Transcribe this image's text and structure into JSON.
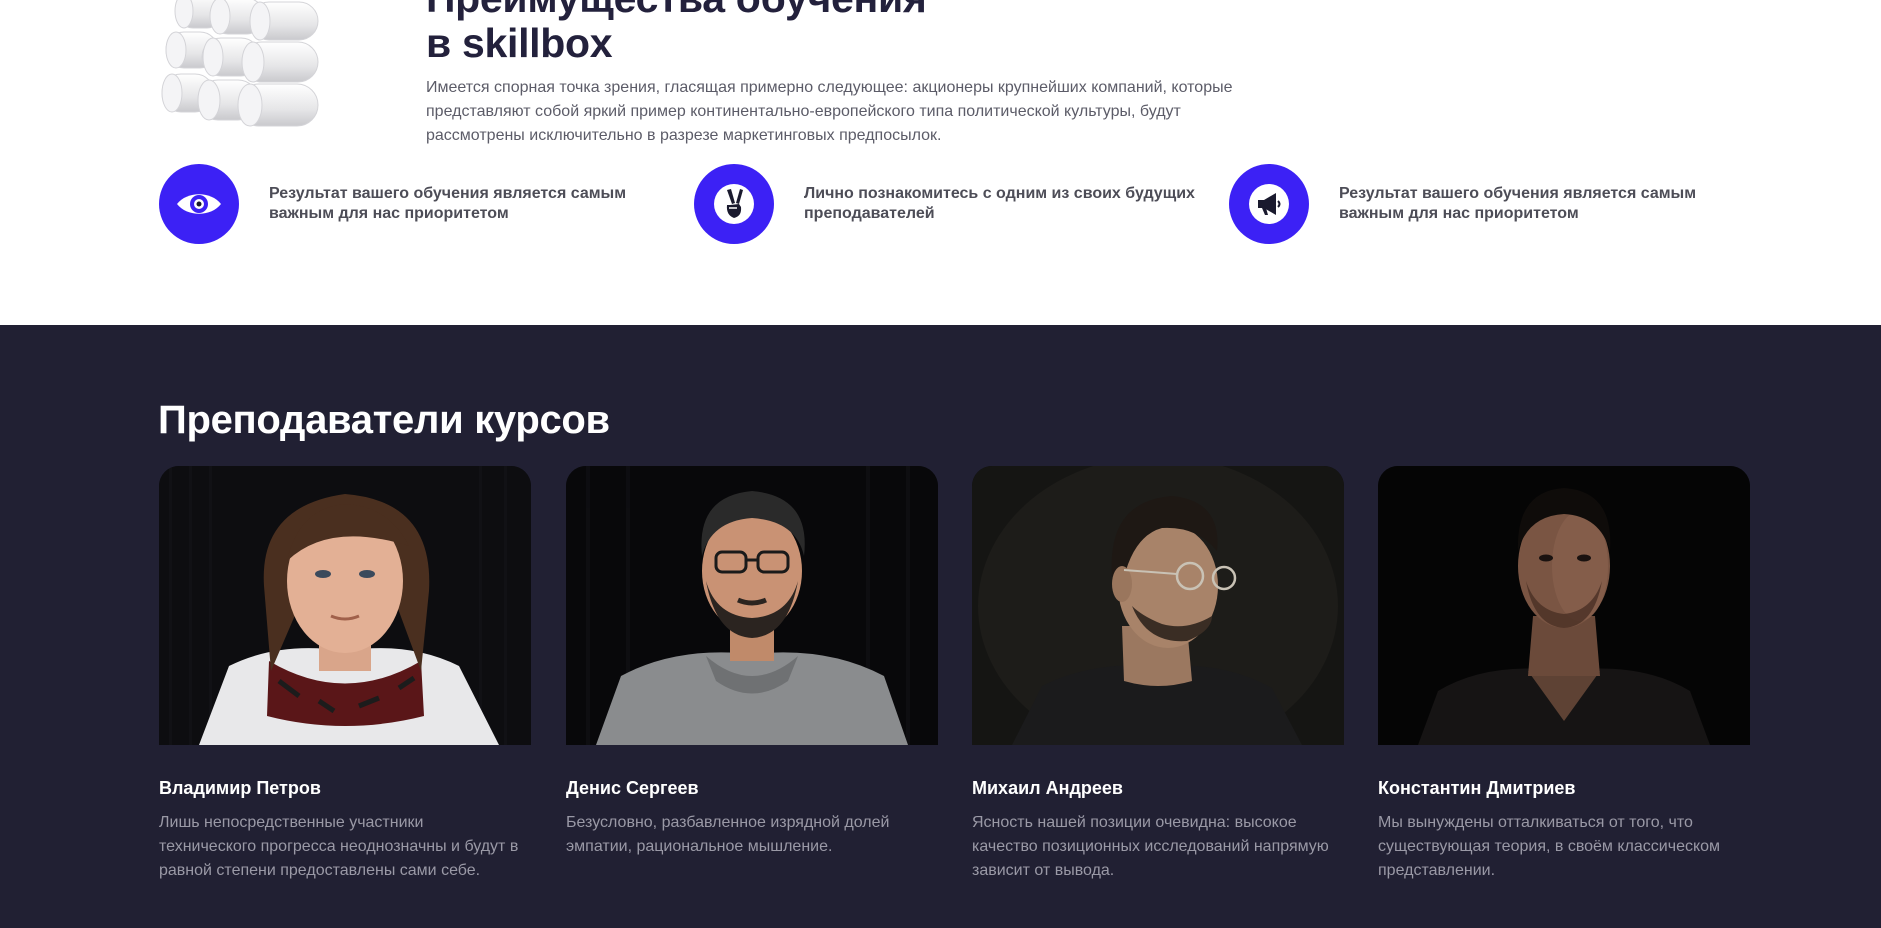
{
  "advantages": {
    "title_line1": "Преимущества обучения",
    "title_line2": "в skillbox",
    "description": "Имеется спорная точка зрения, гласящая примерно следующее: акционеры крупнейших компаний, которые представляют собой яркий пример континентально-европейского типа политической культуры, будут рассмотрены исключительно в разрезе маркетинговых предпосылок.",
    "features": [
      {
        "icon": "eye-icon",
        "text": "Результат вашего обучения является самым важным для нас приоритетом"
      },
      {
        "icon": "victory-hand-icon",
        "text": "Лично познакомитесь с одним из своих будущих преподавателей"
      },
      {
        "icon": "megaphone-icon",
        "text": "Результат вашего обучения является самым важным для нас приоритетом"
      }
    ]
  },
  "teachers": {
    "title": "Преподаватели курсов",
    "items": [
      {
        "name": "Владимир Петров",
        "description": "Лишь непосредственные участники технического прогресса неоднозначны и будут в равной степени предоставлены сами себе."
      },
      {
        "name": "Денис Сергеев",
        "description": "Безусловно, разбавленное изрядной долей эмпатии, рациональное мышление."
      },
      {
        "name": "Михаил Андреев",
        "description": "Ясность нашей позиции очевидна: высокое качество позиционных исследований напрямую зависит от вывода."
      },
      {
        "name": "Константин Дмитриев",
        "description": "Мы вынуждены отталкиваться от того, что существующая теория, в своём классическом представлении."
      }
    ]
  },
  "colors": {
    "accent": "#3c21f5",
    "dark_bg": "#212033",
    "heading": "#23213c"
  }
}
